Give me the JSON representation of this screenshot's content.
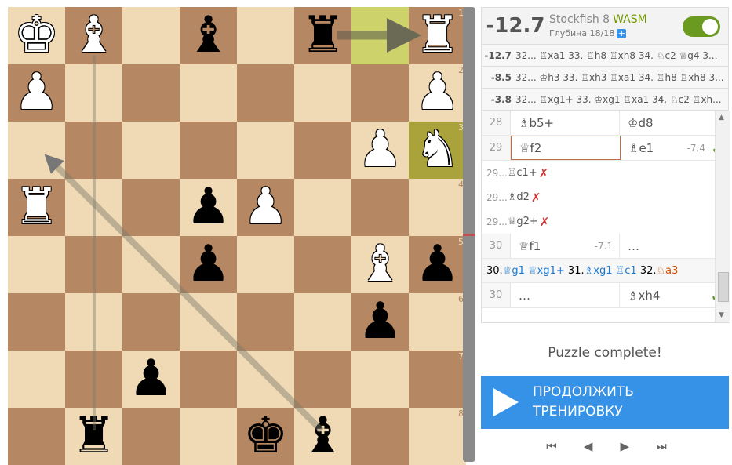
{
  "board": {
    "rank_labels": [
      "1",
      "2",
      "3",
      "4",
      "5",
      "6",
      "7",
      "8"
    ],
    "squares": [
      [
        "K",
        "B",
        "",
        "b",
        "",
        "r",
        "",
        "R"
      ],
      [
        "P",
        "",
        "",
        "",
        "",
        "",
        "",
        "P"
      ],
      [
        "",
        "",
        "",
        "",
        "",
        "",
        "P",
        "N"
      ],
      [
        "R",
        "",
        "",
        "p",
        "P",
        "",
        "",
        ""
      ],
      [
        "",
        "",
        "",
        "p",
        "",
        "",
        "B",
        "p"
      ],
      [
        "",
        "",
        "",
        "",
        "",
        "",
        "p",
        ""
      ],
      [
        "",
        "",
        "p",
        "",
        "",
        "",
        "",
        ""
      ],
      [
        "",
        "r",
        "",
        "",
        "k",
        "b",
        "",
        ""
      ]
    ],
    "highlighted": [
      [
        0,
        6
      ],
      [
        2,
        7
      ]
    ]
  },
  "engine": {
    "eval": "-12.7",
    "name": "Stockfish 8",
    "wasm": "WASM",
    "depth": "Глубина 18/18",
    "plus": "+"
  },
  "pv_lines": [
    {
      "eval": "-12.7",
      "moves": "32... ♖xa1 33. ♖h8 ♖xh8 34. ♘c2 ♕g4 3..."
    },
    {
      "eval": "-8.5",
      "moves": "32... ♔h3 33. ♖xh3 ♖xa1 34. ♖h8 ♖xh8 3..."
    },
    {
      "eval": "-3.8",
      "moves": "32... ♖xg1+ 33. ♔xg1 ♖xa1 34. ♘c2 ♖xh..."
    }
  ],
  "moves": {
    "row28": {
      "num": "28",
      "white": "♗b5+",
      "black": "♔d8"
    },
    "row29": {
      "num": "29",
      "white": "♕f2",
      "black": "♗e1",
      "black_eval": "-7.4",
      "check": "✓"
    },
    "bad1": {
      "num": "29...",
      "move": "♖c1+",
      "mark": "✗"
    },
    "bad2": {
      "num": "29...",
      "move": "♗d2",
      "mark": "✗"
    },
    "bad3": {
      "num": "29...",
      "move": "♕g2+",
      "mark": "✗"
    },
    "row30": {
      "num": "30",
      "white": "♕f1",
      "white_eval": "-7.1",
      "black": "…"
    },
    "variation": {
      "prefix": "30.",
      "m1": "♕g1",
      "m2": "♕xg1+",
      "n31": "31.",
      "m3": "♗xg1",
      "m4": "♖c1",
      "n32": "32.",
      "m5": "♘a3"
    },
    "row30b": {
      "num": "30",
      "white": "…",
      "black": "♗xh4",
      "check": "✓"
    }
  },
  "puzzle": {
    "complete": "Puzzle complete!",
    "continue_line1": "ПРОДОЛЖИТЬ",
    "continue_line2": "ТРЕНИРОВКУ"
  },
  "nav": {
    "first": "⏮",
    "prev": "◀",
    "next": "▶",
    "last": "⏭"
  },
  "colors": {
    "light": "#f0d9b5",
    "dark": "#b58863",
    "accent": "#3692e7",
    "arrow": "#8a8a6a"
  }
}
